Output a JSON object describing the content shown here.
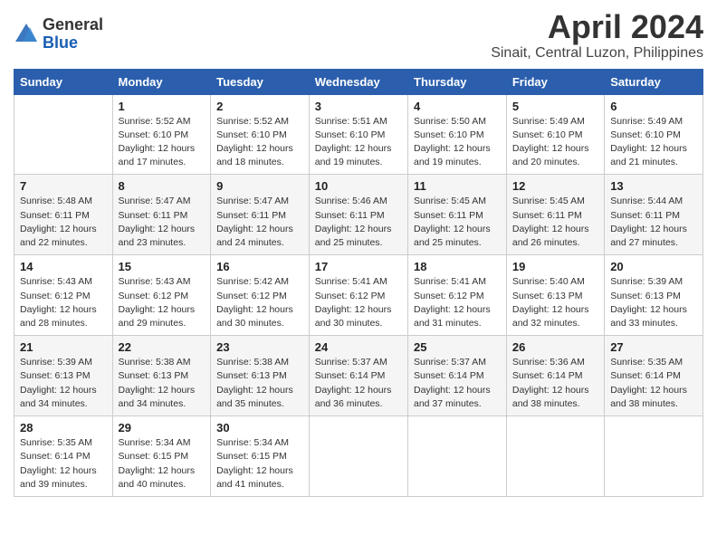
{
  "logo": {
    "general": "General",
    "blue": "Blue"
  },
  "title": "April 2024",
  "location": "Sinait, Central Luzon, Philippines",
  "weekdays": [
    "Sunday",
    "Monday",
    "Tuesday",
    "Wednesday",
    "Thursday",
    "Friday",
    "Saturday"
  ],
  "weeks": [
    [
      {
        "day": "",
        "info": ""
      },
      {
        "day": "1",
        "info": "Sunrise: 5:52 AM\nSunset: 6:10 PM\nDaylight: 12 hours\nand 17 minutes."
      },
      {
        "day": "2",
        "info": "Sunrise: 5:52 AM\nSunset: 6:10 PM\nDaylight: 12 hours\nand 18 minutes."
      },
      {
        "day": "3",
        "info": "Sunrise: 5:51 AM\nSunset: 6:10 PM\nDaylight: 12 hours\nand 19 minutes."
      },
      {
        "day": "4",
        "info": "Sunrise: 5:50 AM\nSunset: 6:10 PM\nDaylight: 12 hours\nand 19 minutes."
      },
      {
        "day": "5",
        "info": "Sunrise: 5:49 AM\nSunset: 6:10 PM\nDaylight: 12 hours\nand 20 minutes."
      },
      {
        "day": "6",
        "info": "Sunrise: 5:49 AM\nSunset: 6:10 PM\nDaylight: 12 hours\nand 21 minutes."
      }
    ],
    [
      {
        "day": "7",
        "info": "Sunrise: 5:48 AM\nSunset: 6:11 PM\nDaylight: 12 hours\nand 22 minutes."
      },
      {
        "day": "8",
        "info": "Sunrise: 5:47 AM\nSunset: 6:11 PM\nDaylight: 12 hours\nand 23 minutes."
      },
      {
        "day": "9",
        "info": "Sunrise: 5:47 AM\nSunset: 6:11 PM\nDaylight: 12 hours\nand 24 minutes."
      },
      {
        "day": "10",
        "info": "Sunrise: 5:46 AM\nSunset: 6:11 PM\nDaylight: 12 hours\nand 25 minutes."
      },
      {
        "day": "11",
        "info": "Sunrise: 5:45 AM\nSunset: 6:11 PM\nDaylight: 12 hours\nand 25 minutes."
      },
      {
        "day": "12",
        "info": "Sunrise: 5:45 AM\nSunset: 6:11 PM\nDaylight: 12 hours\nand 26 minutes."
      },
      {
        "day": "13",
        "info": "Sunrise: 5:44 AM\nSunset: 6:11 PM\nDaylight: 12 hours\nand 27 minutes."
      }
    ],
    [
      {
        "day": "14",
        "info": "Sunrise: 5:43 AM\nSunset: 6:12 PM\nDaylight: 12 hours\nand 28 minutes."
      },
      {
        "day": "15",
        "info": "Sunrise: 5:43 AM\nSunset: 6:12 PM\nDaylight: 12 hours\nand 29 minutes."
      },
      {
        "day": "16",
        "info": "Sunrise: 5:42 AM\nSunset: 6:12 PM\nDaylight: 12 hours\nand 30 minutes."
      },
      {
        "day": "17",
        "info": "Sunrise: 5:41 AM\nSunset: 6:12 PM\nDaylight: 12 hours\nand 30 minutes."
      },
      {
        "day": "18",
        "info": "Sunrise: 5:41 AM\nSunset: 6:12 PM\nDaylight: 12 hours\nand 31 minutes."
      },
      {
        "day": "19",
        "info": "Sunrise: 5:40 AM\nSunset: 6:13 PM\nDaylight: 12 hours\nand 32 minutes."
      },
      {
        "day": "20",
        "info": "Sunrise: 5:39 AM\nSunset: 6:13 PM\nDaylight: 12 hours\nand 33 minutes."
      }
    ],
    [
      {
        "day": "21",
        "info": "Sunrise: 5:39 AM\nSunset: 6:13 PM\nDaylight: 12 hours\nand 34 minutes."
      },
      {
        "day": "22",
        "info": "Sunrise: 5:38 AM\nSunset: 6:13 PM\nDaylight: 12 hours\nand 34 minutes."
      },
      {
        "day": "23",
        "info": "Sunrise: 5:38 AM\nSunset: 6:13 PM\nDaylight: 12 hours\nand 35 minutes."
      },
      {
        "day": "24",
        "info": "Sunrise: 5:37 AM\nSunset: 6:14 PM\nDaylight: 12 hours\nand 36 minutes."
      },
      {
        "day": "25",
        "info": "Sunrise: 5:37 AM\nSunset: 6:14 PM\nDaylight: 12 hours\nand 37 minutes."
      },
      {
        "day": "26",
        "info": "Sunrise: 5:36 AM\nSunset: 6:14 PM\nDaylight: 12 hours\nand 38 minutes."
      },
      {
        "day": "27",
        "info": "Sunrise: 5:35 AM\nSunset: 6:14 PM\nDaylight: 12 hours\nand 38 minutes."
      }
    ],
    [
      {
        "day": "28",
        "info": "Sunrise: 5:35 AM\nSunset: 6:14 PM\nDaylight: 12 hours\nand 39 minutes."
      },
      {
        "day": "29",
        "info": "Sunrise: 5:34 AM\nSunset: 6:15 PM\nDaylight: 12 hours\nand 40 minutes."
      },
      {
        "day": "30",
        "info": "Sunrise: 5:34 AM\nSunset: 6:15 PM\nDaylight: 12 hours\nand 41 minutes."
      },
      {
        "day": "",
        "info": ""
      },
      {
        "day": "",
        "info": ""
      },
      {
        "day": "",
        "info": ""
      },
      {
        "day": "",
        "info": ""
      }
    ]
  ]
}
